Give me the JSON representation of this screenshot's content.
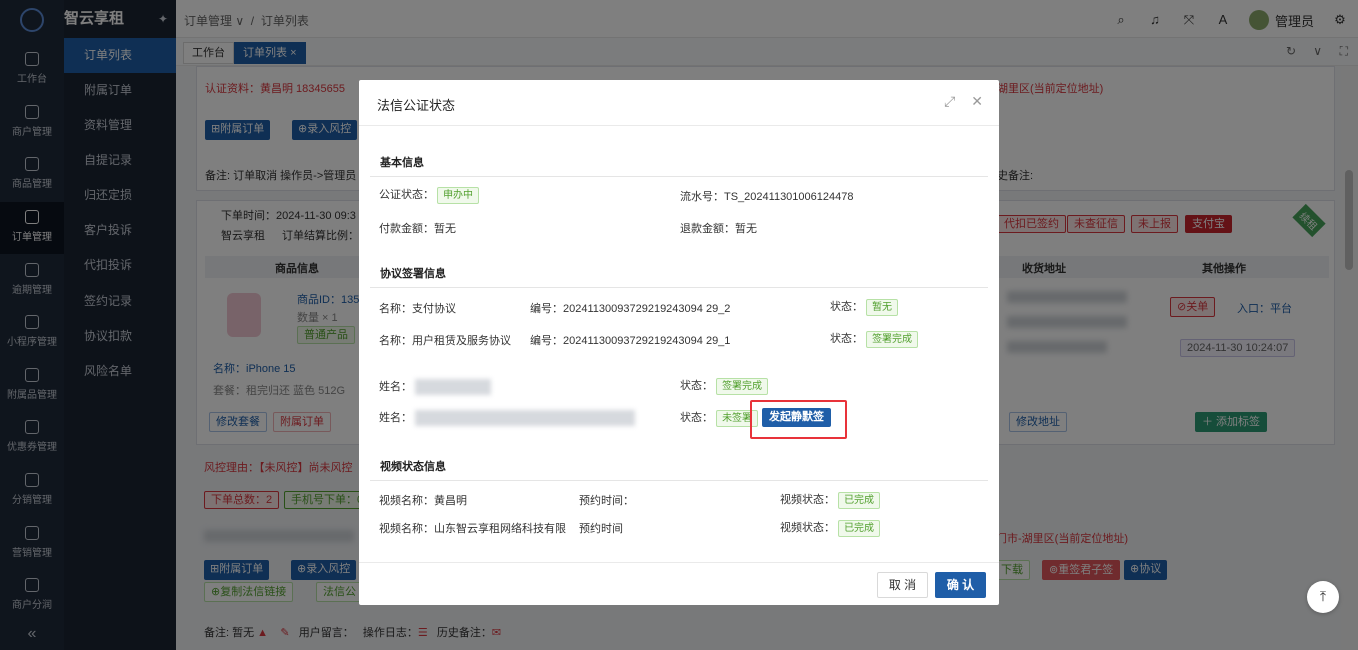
{
  "app": {
    "brand": "智云享租",
    "rail": [
      "工作台",
      "商户管理",
      "商品管理",
      "订单管理",
      "逾期管理",
      "小程序管理",
      "附属品管理",
      "优惠券管理",
      "分销管理",
      "营销管理",
      "商户分润"
    ],
    "submenu": [
      "订单列表",
      "附属订单",
      "资料管理",
      "自提记录",
      "归还定损",
      "客户投诉",
      "代扣投诉",
      "签约记录",
      "协议扣款",
      "风险名单"
    ],
    "collapse": "«"
  },
  "header": {
    "crumb_parent": "订单管理",
    "crumb_current": "订单列表",
    "user": "管理员"
  },
  "tabs": [
    "工作台",
    "订单列表"
  ],
  "background": {
    "auth_info": "认证资料：黄昌明  18345655",
    "addr_right": "湖里区(当前定位地址)",
    "btn_attach": "⊞附属订单",
    "btn_risk": "⊕录入风控",
    "remark": "备注: 订单取消 操作员->管理员",
    "history_remark": "史备注:",
    "order_time": "下单时间：2024-11-30 09:3",
    "company": "智云享租",
    "settle": "订单结算比例：",
    "tags_right": [
      "代扣已签约",
      "未查征信",
      "未上报",
      "支付宝"
    ],
    "corner_badge": "续租",
    "col_product": "商品信息",
    "col_address": "收货地址",
    "col_ops": "其他操作",
    "product_id": "商品ID：135",
    "qty": "数量 × 1",
    "normal_tag": "普通产品",
    "name": "名称：iPhone 15",
    "package": "套餐：租完归还 蓝色 512G",
    "btn_close": "⊘关单",
    "entry": "入口：平台",
    "datetime": "2024-11-30 10:24:07",
    "btn_edit_pkg": "修改套餐",
    "btn_attach2": "附属订单",
    "btn_edit_addr": "修改地址",
    "btn_add_tag": "＋ 添加标签",
    "risk_reason": "风控理由：【未风控】尚未风控",
    "order_total": "下单总数：2",
    "phone_orders": "手机号下单：0",
    "addr_right2": "门市-湖里区(当前定位地址)",
    "btn_attach3": "⊞附属订单",
    "btn_risk2": "⊕录入风控",
    "btn_download": "下载",
    "btn_resign": "⊚重签君子签",
    "btn_protocol": "⊕协议",
    "btn_copy_link": "⊕复制法信链接",
    "btn_fx": "法信公",
    "remark2": "备注: 暂无",
    "user_msg": "用户留言：",
    "op_log": "操作日志：",
    "history_remark2": "历史备注："
  },
  "dialog": {
    "title": "法信公证状态",
    "basic": {
      "title": "基本信息",
      "status_label": "公证状态：",
      "status_tag": "申办中",
      "serial_label": "流水号：",
      "serial": "TS_202411301006124478",
      "pay_label": "付款金额：",
      "pay": "暂无",
      "refund_label": "退款金额：",
      "refund": "暂无"
    },
    "agreement": {
      "title": "协议签署信息",
      "rows": [
        {
          "name_label": "名称：",
          "name": "支付协议",
          "no_label": "编号：",
          "no": "20241130093729219243094 29_2",
          "state_label": "状态：",
          "state": "暂无"
        },
        {
          "name_label": "名称：",
          "name": "用户租赁及服务协议",
          "no_label": "编号：",
          "no": "20241130093729219243094 29_1",
          "state_label": "状态：",
          "state": "签署完成"
        }
      ],
      "signers": [
        {
          "name_label": "姓名：",
          "state_label": "状态：",
          "state": "签署完成"
        },
        {
          "name_label": "姓名：",
          "state_label": "状态：",
          "state": "未签署",
          "action": "发起静默签"
        }
      ]
    },
    "video": {
      "title": "视频状态信息",
      "name_label": "视频名称：",
      "name": "黄昌明",
      "time_label": "预约时间：",
      "state_label": "视频状态：",
      "state": "已完成",
      "row2_name": "视频名称：山东智云享租网络科技有限",
      "row2_time": "预约时间",
      "row2_state": "视频状态：",
      "row2_tag": "已完成"
    },
    "cancel": "取 消",
    "ok": "确 认"
  }
}
